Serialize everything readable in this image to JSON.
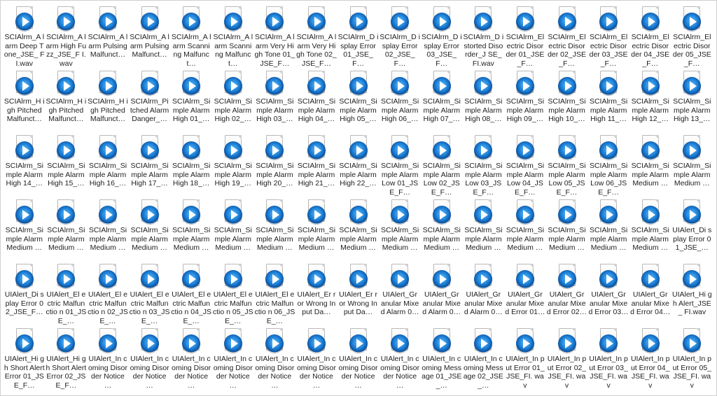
{
  "files": [
    "SCIAlrm_A larm Deep Tone_JSE_ FI.wav",
    "SCIAlrm_A larm High Fuzz_JSE_F I.wav",
    "SCIAlrm_A larm Pulsing Malfunct…",
    "SCIAlrm_A larm Pulsing Malfunct…",
    "SCIAlrm_A larm Scanning Malfunct…",
    "SCIAlrm_A larm Scanning Malfunct…",
    "SCIAlrm_A larm Very High Tone 01_JSE_F…",
    "SCIAlrm_A larm Very High Tone 02_JSE_F…",
    "SCIAlrm_D isplay Error 01_JSE_F…",
    "SCIAlrm_D isplay Error 02_JSE_F…",
    "SCIAlrm_D isplay Error 03_JSE_F…",
    "SCIAlrm_D istorted Disorder_J SE_FI.wav",
    "SCIAlrm_El ectric Disorder 01_JSE_F…",
    "SCIAlrm_El ectric Disorder 02_JSE_F…",
    "SCIAlrm_El ectric Disorder 03_JSE_F…",
    "SCIAlrm_El ectric Disorder 04_JSE_F…",
    "SCIAlrm_El ectric Disorder 05_JSE_F…",
    "SCIAlrm_H igh Pitched Malfunct…",
    "SCIAlrm_H igh Pitched Malfunct…",
    "SCIAlrm_H igh Pitched Malfunct…",
    "SCIAlrm_Pi tched Alarm Danger_…",
    "SCIAlrm_Si mple Alarm High 01_…",
    "SCIAlrm_Si mple Alarm High 02_…",
    "SCIAlrm_Si mple Alarm High 03_…",
    "SCIAlrm_Si mple Alarm High 04_…",
    "SCIAlrm_Si mple Alarm High 05_…",
    "SCIAlrm_Si mple Alarm High 06_…",
    "SCIAlrm_Si mple Alarm High 07_…",
    "SCIAlrm_Si mple Alarm High 08_…",
    "SCIAlrm_Si mple Alarm High 09_…",
    "SCIAlrm_Si mple Alarm High 10_…",
    "SCIAlrm_Si mple Alarm High 11_…",
    "SCIAlrm_Si mple Alarm High 12_…",
    "SCIAlrm_Si mple Alarm High 13_…",
    "SCIAlrm_Si mple Alarm High 14_…",
    "SCIAlrm_Si mple Alarm High 15_…",
    "SCIAlrm_Si mple Alarm High 16_…",
    "SCIAlrm_Si mple Alarm High 17_…",
    "SCIAlrm_Si mple Alarm High 18_…",
    "SCIAlrm_Si mple Alarm High 19_…",
    "SCIAlrm_Si mple Alarm High 20_…",
    "SCIAlrm_Si mple Alarm High 21_…",
    "SCIAlrm_Si mple Alarm High 22_…",
    "SCIAlrm_Si mple Alarm Low 01_JSE_F…",
    "SCIAlrm_Si mple Alarm Low 02_JSE_F…",
    "SCIAlrm_Si mple Alarm Low 03_JSE_F…",
    "SCIAlrm_Si mple Alarm Low 04_JSE_F…",
    "SCIAlrm_Si mple Alarm Low 05_JSE_F…",
    "SCIAlrm_Si mple Alarm Low 06_JSE_F…",
    "SCIAlrm_Si mple Alarm Medium …",
    "SCIAlrm_Si mple Alarm Medium …",
    "SCIAlrm_Si mple Alarm Medium …",
    "SCIAlrm_Si mple Alarm Medium …",
    "SCIAlrm_Si mple Alarm Medium …",
    "SCIAlrm_Si mple Alarm Medium …",
    "SCIAlrm_Si mple Alarm Medium …",
    "SCIAlrm_Si mple Alarm Medium …",
    "SCIAlrm_Si mple Alarm Medium …",
    "SCIAlrm_Si mple Alarm Medium …",
    "SCIAlrm_Si mple Alarm Medium …",
    "SCIAlrm_Si mple Alarm Medium …",
    "SCIAlrm_Si mple Alarm Medium …",
    "SCIAlrm_Si mple Alarm Medium …",
    "SCIAlrm_Si mple Alarm Medium …",
    "SCIAlrm_Si mple Alarm Medium …",
    "SCIAlrm_Si mple Alarm Medium …",
    "SCIAlrm_Si mple Alarm Medium …",
    "UIAlert_Di splay Error 01_JSE_…",
    "UIAlert_Di splay Error 02_JSE_F…",
    "UIAlert_El ectric Malfunctio n 01_JSE_…",
    "UIAlert_El ectric Malfunctio n 02_JSE_…",
    "UIAlert_El ectric Malfunctio n 03_JSE_…",
    "UIAlert_El ectric Malfunctio n 04_JSE_…",
    "UIAlert_El ectric Malfunctio n 05_JSE_…",
    "UIAlert_El ectric Malfunctio n 06_JSE_…",
    "UIAlert_Er ror Wrong Input Da…",
    "UIAlert_Er ror Wrong Input Da…",
    "UIAlert_Gr anular Mixed Alarm 0…",
    "UIAlert_Gr anular Mixed Alarm 0…",
    "UIAlert_Gr anular Mixed Alarm 0…",
    "UIAlert_Gr anular Mixed Error 01…",
    "UIAlert_Gr anular Mixed Error 02…",
    "UIAlert_Gr anular Mixed Error 03…",
    "UIAlert_Gr anular Mixed Error 04…",
    "UIAlert_Hi gh Alert_JSE_ FI.wav",
    "UIAlert_Hi gh Short Alert Error 01_JSE_F…",
    "UIAlert_Hi gh Short Alert Error 02_JSE_F…",
    "UIAlert_In coming Disorder Notice …",
    "UIAlert_In coming Disorder Notice …",
    "UIAlert_In coming Disorder Notice …",
    "UIAlert_In coming Disorder Notice …",
    "UIAlert_In coming Disorder Notice …",
    "UIAlert_In coming Disorder Notice …",
    "UIAlert_In coming Disorder Notice …",
    "UIAlert_In coming Disorder Notice …",
    "UIAlert_In coming Message 01_JSE_…",
    "UIAlert_In coming Message 02_JSE_…",
    "UIAlert_In put Error 01_JSE_FI. wav",
    "UIAlert_In put Error 02_JSE_FI. wav",
    "UIAlert_In put Error 03_JSE_FI. wav",
    "UIAlert_In put Error 04_JSE_FI. wav",
    "UIAlert_In put Error 05_JSE_FI. wav"
  ]
}
